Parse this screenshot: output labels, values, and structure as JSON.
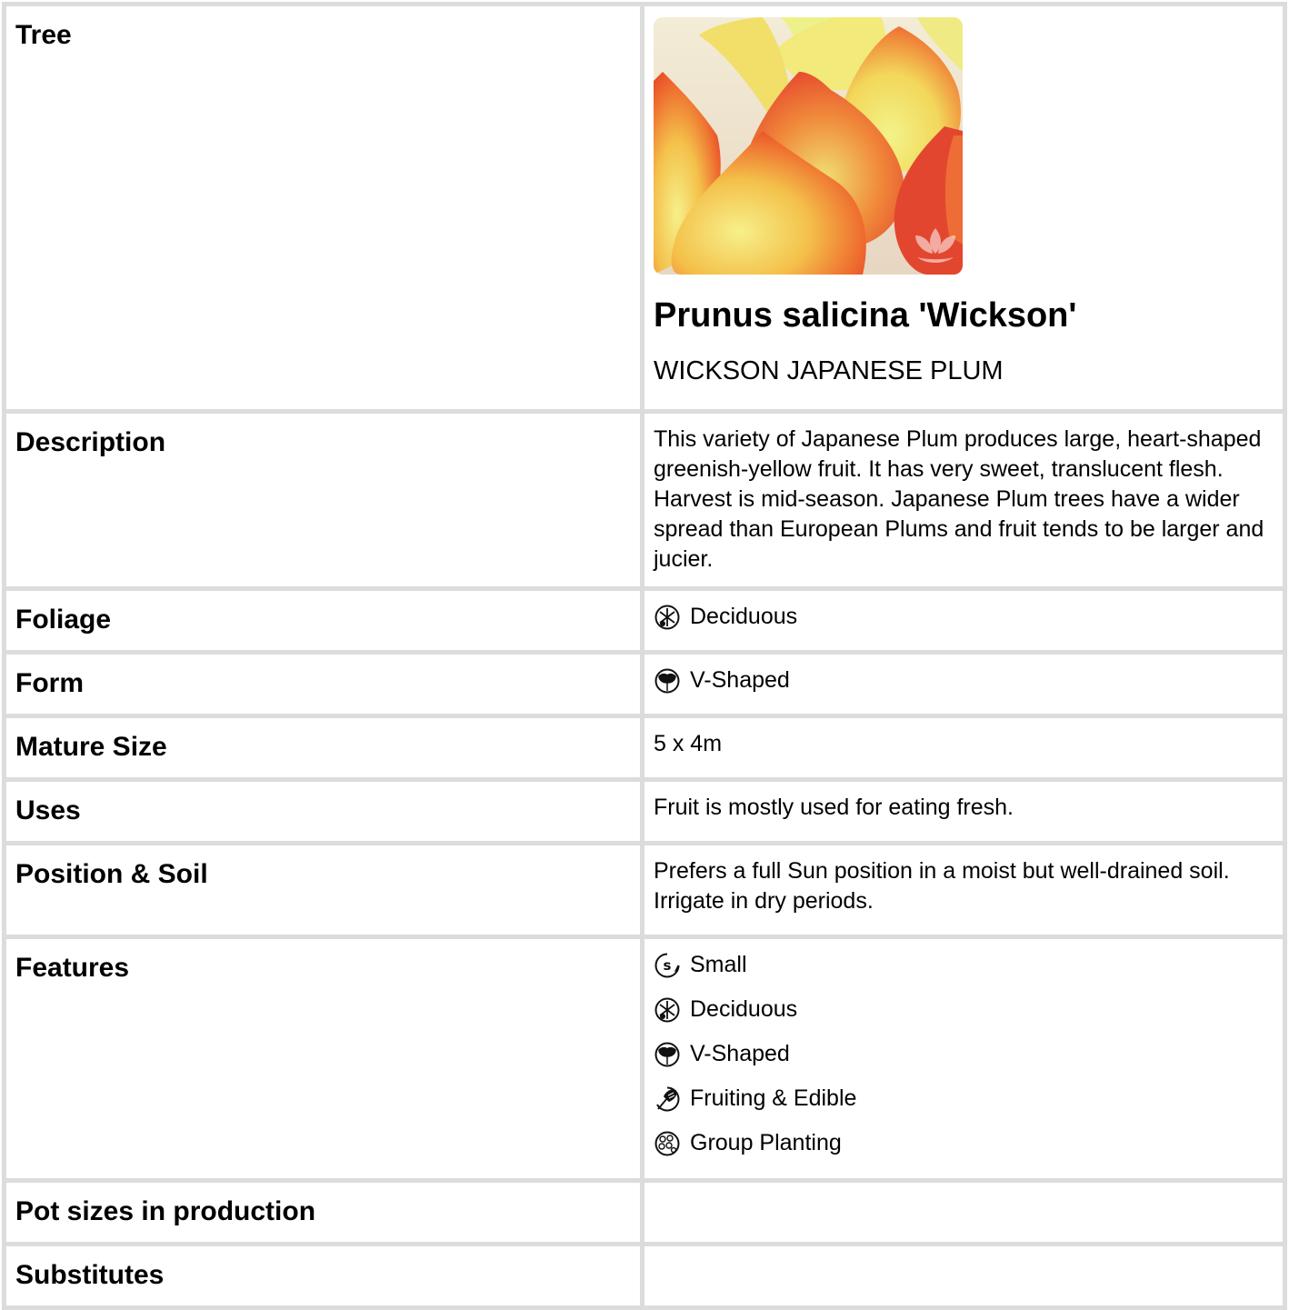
{
  "tree": {
    "label": "Tree",
    "image_alt": "Wickson Japanese Plum fruit",
    "botanical_name": "Prunus salicina 'Wickson'",
    "common_name": "WICKSON JAPANESE PLUM"
  },
  "description": {
    "label": "Description",
    "text": "This variety of Japanese Plum produces large, heart-shaped greenish-yellow fruit. It has very sweet, translucent flesh. Harvest is mid-season. Japanese Plum trees have a wider spread than European Plums and fruit tends to be larger and jucier."
  },
  "foliage": {
    "label": "Foliage",
    "value": "Deciduous",
    "icon": "deciduous-icon"
  },
  "form": {
    "label": "Form",
    "value": "V-Shaped",
    "icon": "v-shaped-icon"
  },
  "mature_size": {
    "label": "Mature Size",
    "value": "5 x 4m"
  },
  "uses": {
    "label": "Uses",
    "value": "Fruit is mostly used for eating fresh."
  },
  "position_soil": {
    "label": "Position & Soil",
    "value": "Prefers a full Sun position in a moist but well-drained soil. Irrigate in dry periods."
  },
  "features": {
    "label": "Features",
    "items": [
      {
        "label": "Small",
        "icon": "small-icon"
      },
      {
        "label": "Deciduous",
        "icon": "deciduous-icon"
      },
      {
        "label": "V-Shaped",
        "icon": "v-shaped-icon"
      },
      {
        "label": "Fruiting & Edible",
        "icon": "fruiting-edible-icon"
      },
      {
        "label": "Group Planting",
        "icon": "group-planting-icon"
      }
    ]
  },
  "pot_sizes": {
    "label": "Pot sizes in production",
    "value": ""
  },
  "substitutes": {
    "label": "Substitutes",
    "value": ""
  }
}
